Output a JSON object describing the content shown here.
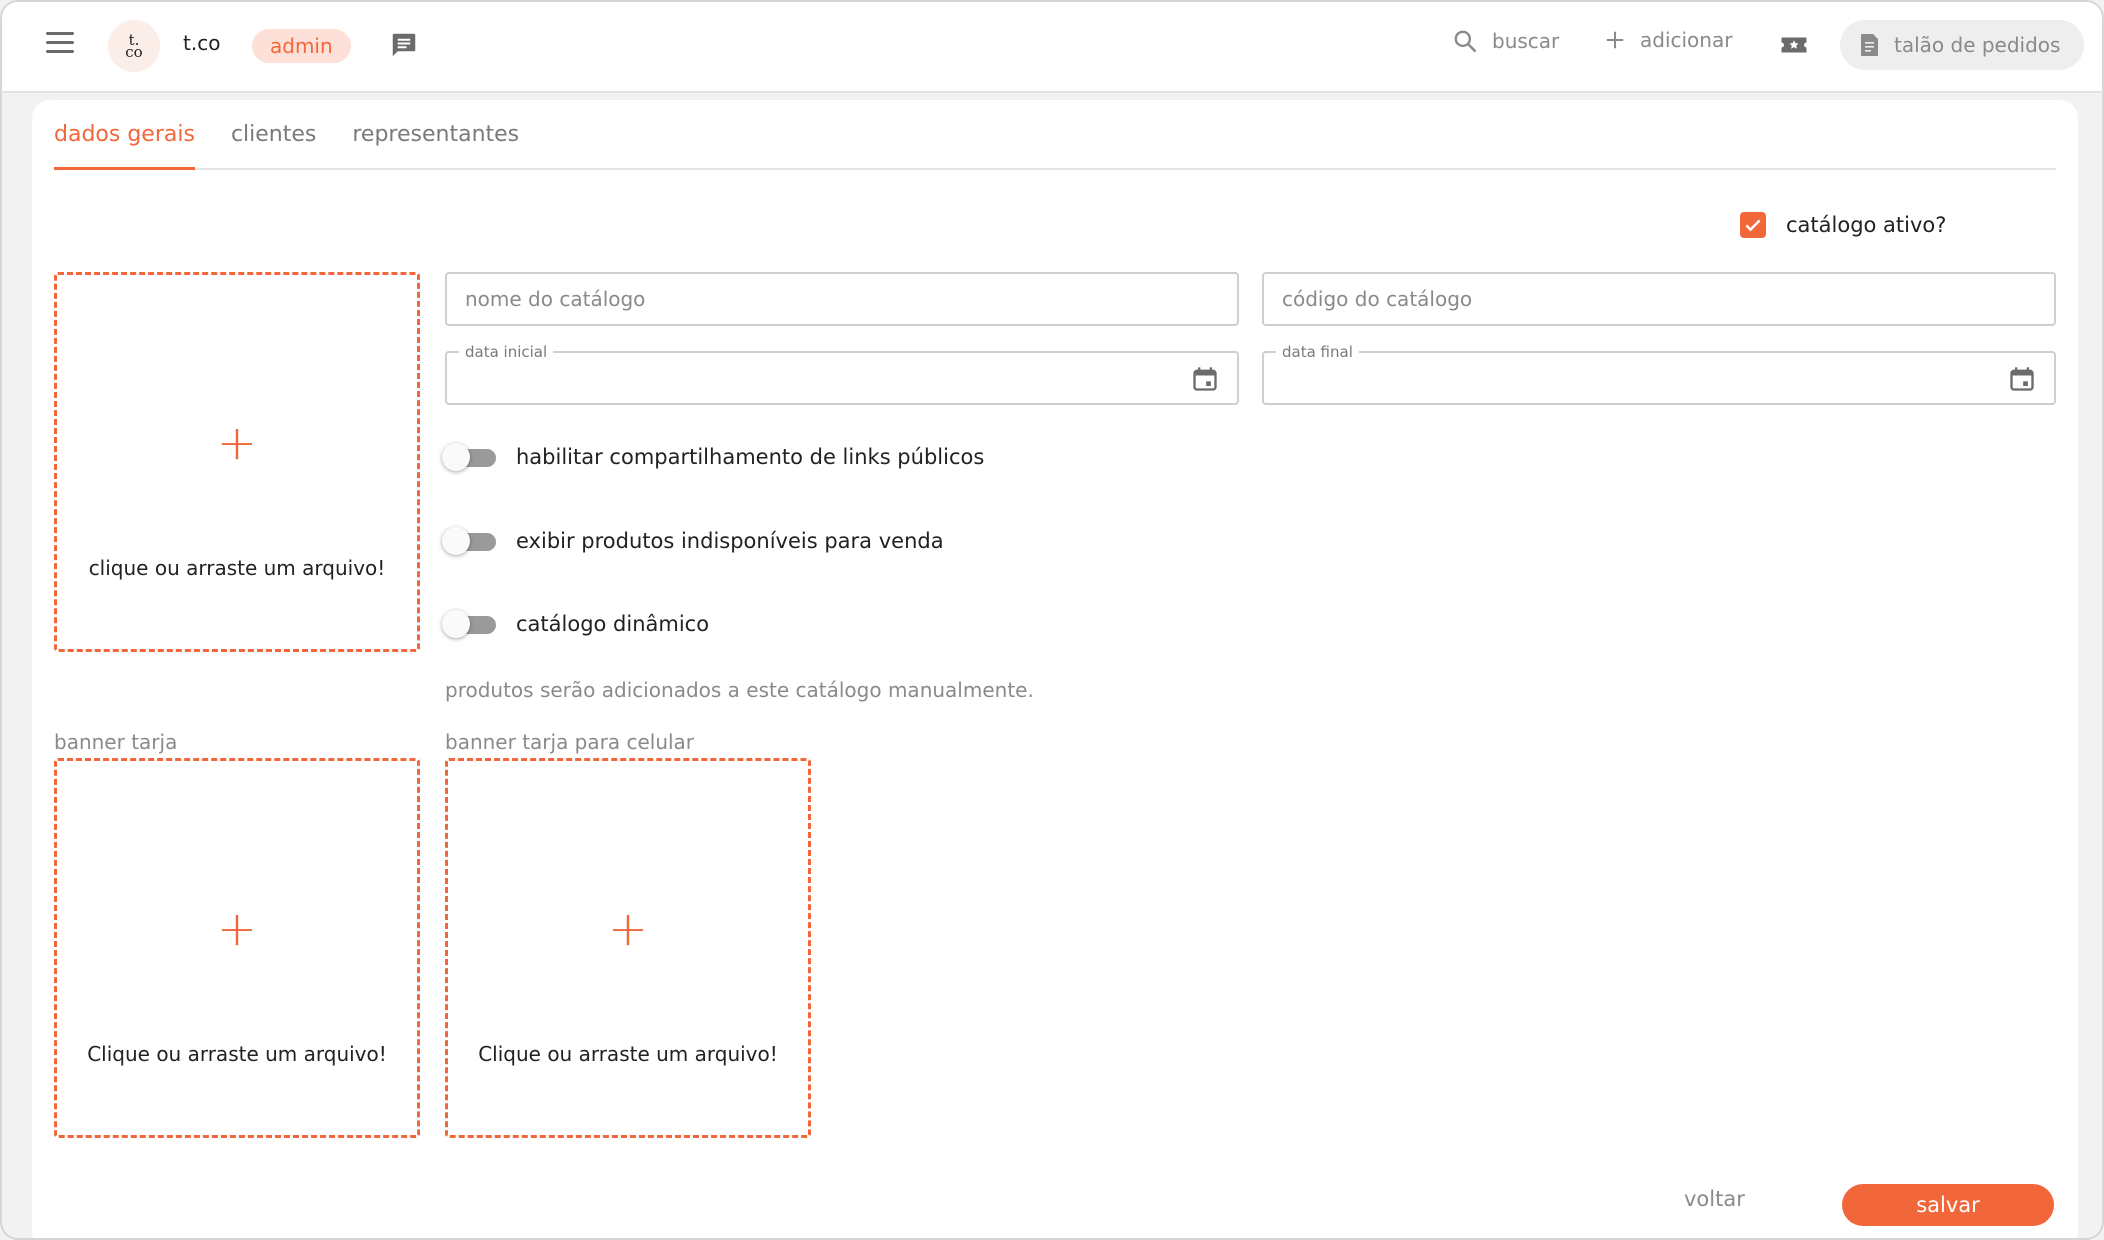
{
  "header": {
    "logo_text": "t.co",
    "brand_name": "t.co",
    "role_badge": "admin",
    "search_label": "buscar",
    "add_label": "adicionar",
    "order_book_label": "talão de pedidos"
  },
  "tabs": [
    {
      "label": "dados gerais",
      "active": true
    },
    {
      "label": "clientes",
      "active": false
    },
    {
      "label": "representantes",
      "active": false
    }
  ],
  "form": {
    "active_checkbox": {
      "label": "catálogo ativo?",
      "checked": true
    },
    "main_image_dropzone": {
      "text": "clique ou arraste um arquivo!"
    },
    "catalog_name": {
      "placeholder": "nome do catálogo",
      "value": ""
    },
    "catalog_code": {
      "placeholder": "código do catálogo",
      "value": ""
    },
    "start_date": {
      "label": "data inicial",
      "value": ""
    },
    "end_date": {
      "label": "data final",
      "value": ""
    },
    "toggles": [
      {
        "label": "habilitar compartilhamento de links públicos",
        "on": false
      },
      {
        "label": "exibir produtos indisponíveis para venda",
        "on": false
      },
      {
        "label": "catálogo dinâmico",
        "on": false
      }
    ],
    "hint": "produtos serão adicionados a este catálogo manualmente.",
    "banner": {
      "label": "banner tarja",
      "dropzone_text": "Clique ou arraste um arquivo!"
    },
    "banner_mobile": {
      "label": "banner tarja para celular",
      "dropzone_text": "Clique ou arraste um arquivo!"
    }
  },
  "footer": {
    "back_label": "voltar",
    "save_label": "salvar"
  },
  "colors": {
    "accent": "#f2673a",
    "badge_bg": "#fde0d7",
    "muted_text": "#8a8a8a"
  }
}
